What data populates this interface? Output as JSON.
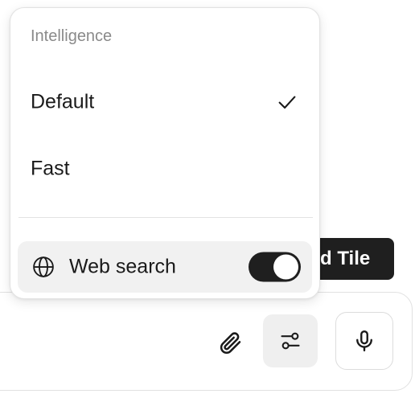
{
  "background": {
    "button_label": "Add Tile"
  },
  "composer": {
    "attach_icon": "paperclip-icon",
    "settings_icon": "sliders-icon",
    "mic_icon": "microphone-icon"
  },
  "menu": {
    "section_header": "Intelligence",
    "items": [
      {
        "label": "Default",
        "selected": true
      },
      {
        "label": "Fast",
        "selected": false
      }
    ],
    "web_search": {
      "label": "Web search",
      "icon": "globe-icon",
      "enabled": true
    }
  },
  "colors": {
    "toggle_on": "#1f1f1f",
    "row_highlight": "#f1f1f1",
    "header_text": "#8a8a8a"
  }
}
